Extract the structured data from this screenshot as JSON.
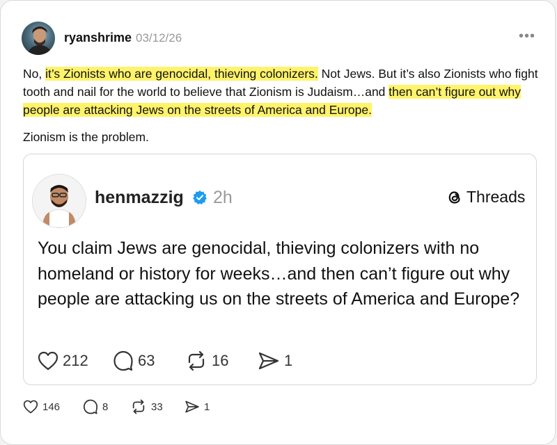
{
  "post": {
    "username": "ryanshrime",
    "date": "03/12/26",
    "more": "•••",
    "text_parts": {
      "p1": "No, ",
      "p2": "it’s Zionists who are genocidal, thieving colonizers.",
      "p3": " Not Jews. But it’s also Zionists who fight tooth and nail for the world to believe that Zionism is Judaism…and ",
      "p4": "then can’t figure out why people are attacking Jews on the streets of America and Europe."
    },
    "text2": "Zionism is the problem.",
    "stats": {
      "likes": "146",
      "replies": "8",
      "reposts": "33",
      "shares": "1"
    }
  },
  "embed": {
    "username": "henmazzig",
    "time": "2h",
    "brand": "Threads",
    "text": "You claim Jews are genocidal, thieving colonizers with no homeland or history for weeks…and then can’t figure out why people are attacking us on the streets of America and Europe?",
    "stats": {
      "likes": "212",
      "replies": "63",
      "reposts": "16",
      "shares": "1"
    }
  },
  "colors": {
    "highlight": "#fff36b",
    "verified": "#1d9bf0",
    "muted": "#999999"
  },
  "icons": [
    "heart-icon",
    "comment-icon",
    "repost-icon",
    "share-icon",
    "verified-icon",
    "threads-logo-icon",
    "more-icon"
  ]
}
